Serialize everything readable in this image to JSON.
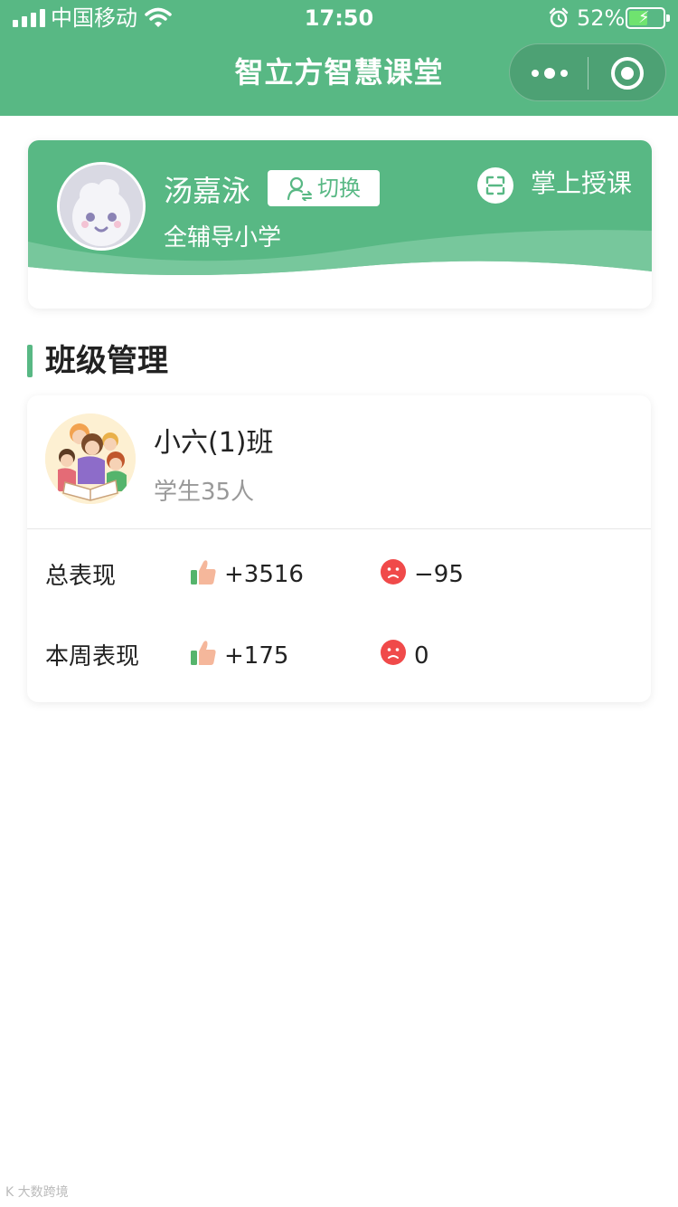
{
  "status_bar": {
    "carrier": "中国移动",
    "time": "17:50",
    "battery_percent": "52%",
    "battery_level": 0.52,
    "icons": [
      "signal-icon",
      "wifi-icon",
      "alarm-icon",
      "battery-icon"
    ]
  },
  "nav": {
    "title": "智立方智慧课堂",
    "background_color": "#58b884",
    "menu_icons": [
      "more-icon",
      "target-icon"
    ]
  },
  "profile": {
    "name": "汤嘉泳",
    "switch_label": "切换",
    "school": "全辅导小学",
    "teach_label": "掌上授课",
    "icons": [
      "avatar",
      "user-switch-icon",
      "scan-icon"
    ]
  },
  "section": {
    "title": "班级管理"
  },
  "class": {
    "name": "小六(1)班",
    "students": "学生35人",
    "stats": [
      {
        "label": "总表现",
        "positive": "+3516",
        "negative": "−95"
      },
      {
        "label": "本周表现",
        "positive": "+175",
        "negative": "0"
      }
    ],
    "icons": [
      "class-avatar",
      "thumbs-up-icon",
      "frown-icon"
    ],
    "positive_color": "#f5b79b",
    "negative_color": "#f04a4a"
  },
  "watermark": "K 大数跨境"
}
